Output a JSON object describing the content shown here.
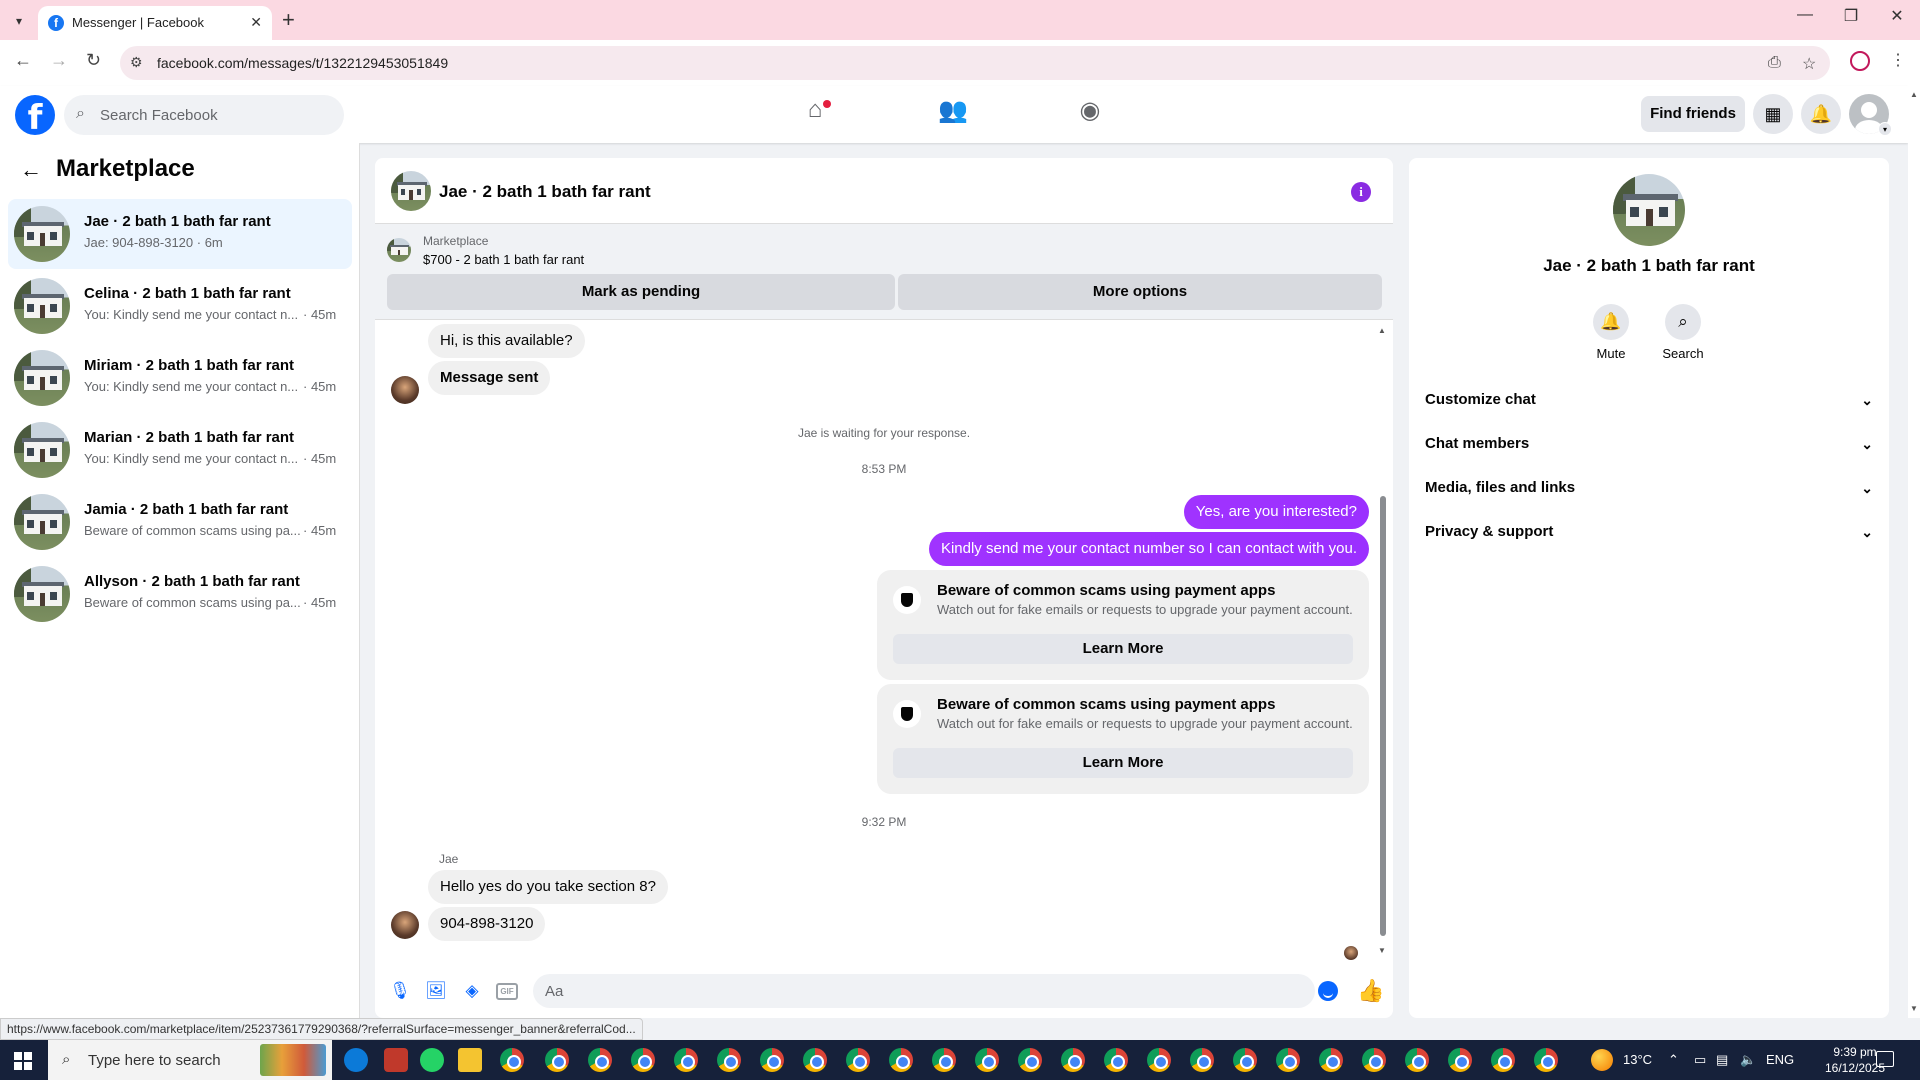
{
  "browser": {
    "tab_title": "Messenger | Facebook",
    "url": "facebook.com/messages/t/1322129453051849",
    "status_url": "https://www.facebook.com/marketplace/item/25237361779290368/?referralSurface=messenger_banner&referralCod..."
  },
  "fbnav": {
    "logo": "f",
    "search_placeholder": "Search Facebook",
    "find_friends": "Find friends"
  },
  "sidebar": {
    "title": "Marketplace",
    "conversations": [
      {
        "name": "Jae · 2 bath 1 bath far rant",
        "preview": "Jae: 904-898-3120 · 6m",
        "time": ""
      },
      {
        "name": "Celina · 2 bath 1 bath far rant",
        "preview": "You: Kindly send me your contact n...",
        "time": "· 45m"
      },
      {
        "name": "Miriam · 2 bath 1 bath far rant",
        "preview": "You: Kindly send me your contact n...",
        "time": "· 45m"
      },
      {
        "name": "Marian · 2 bath 1 bath far rant",
        "preview": "You: Kindly send me your contact n...",
        "time": "· 45m"
      },
      {
        "name": "Jamia · 2 bath 1 bath far rant",
        "preview": "Beware of common scams using pa...",
        "time": "· 45m"
      },
      {
        "name": "Allyson · 2 bath 1 bath far rant",
        "preview": "Beware of common scams using pa...",
        "time": "· 45m"
      }
    ]
  },
  "chat": {
    "title": "Jae · 2 bath 1 bath far rant",
    "banner_label": "Marketplace",
    "banner_listing": "$700 - 2 bath 1 bath far rant",
    "mark_pending": "Mark as pending",
    "more_options": "More options",
    "msg_available": "Hi, is this available?",
    "msg_sent": "Message sent",
    "waiting": "Jae is waiting for your response.",
    "time1": "8:53 PM",
    "msg_interested": "Yes, are you interested?",
    "msg_contact": "Kindly send me your contact number so I can contact with you.",
    "warning_title": "Beware of common scams using payment apps",
    "warning_body": "Watch out for fake emails or requests to upgrade your payment account.",
    "learn_more": "Learn More",
    "time2": "9:32 PM",
    "sender": "Jae",
    "msg_section8": "Hello yes do you take section 8?",
    "msg_phone": "904-898-3120",
    "composer_placeholder": "Aa",
    "gif_label": "GIF"
  },
  "right_panel": {
    "name": "Jae · 2 bath 1 bath far rant",
    "mute": "Mute",
    "search": "Search",
    "rows": [
      "Customize chat",
      "Chat members",
      "Media, files and links",
      "Privacy & support"
    ]
  },
  "taskbar": {
    "search_placeholder": "Type here to search",
    "temperature": "13°C",
    "language": "ENG",
    "time": "9:39 pm",
    "date": "16/12/2025"
  },
  "colors": {
    "brand_blue": "#0866ff",
    "messenger_purple": "#9b30ff",
    "selected_row": "#ebf5ff"
  }
}
